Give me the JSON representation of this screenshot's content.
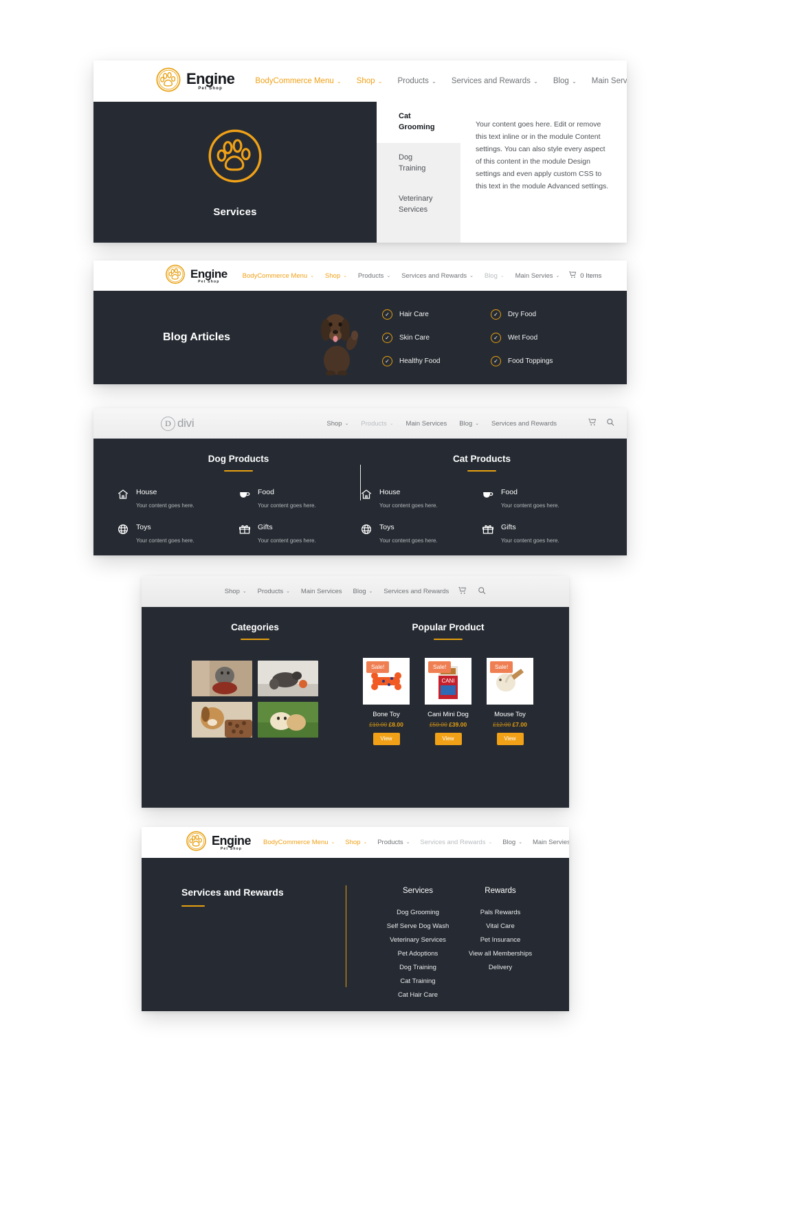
{
  "brand": {
    "name": "Engine",
    "tagline": "Pet Shop",
    "accent": "#e8a010",
    "dark": "#262b33",
    "sale_color": "#ef7f52"
  },
  "card1": {
    "nav": [
      {
        "label": "BodyCommerce Menu",
        "caret": "⌄",
        "style": "orange"
      },
      {
        "label": "Shop",
        "caret": "⌄",
        "style": "orange"
      },
      {
        "label": "Products",
        "caret": "⌄",
        "style": "gray"
      },
      {
        "label": "Services and Rewards",
        "caret": "⌄",
        "style": "gray"
      },
      {
        "label": "Blog",
        "caret": "⌄",
        "style": "gray"
      },
      {
        "label": "Main Servies",
        "caret": "⌄",
        "style": "gray"
      }
    ],
    "hero_title": "Services",
    "hero_icon": "paw-print-icon",
    "tabs": [
      {
        "label": "Cat Grooming",
        "active": true
      },
      {
        "label": "Dog Training",
        "active": false
      },
      {
        "label": "Veterinary Services",
        "active": false
      }
    ],
    "body_text": "Your content goes here. Edit or remove this text inline or in the module Content settings. You can also style every aspect of this content in the module Design settings and even apply custom CSS to this text in the module Advanced settings."
  },
  "card2": {
    "nav": [
      {
        "label": "BodyCommerce Menu",
        "caret": "⌄",
        "style": "orange"
      },
      {
        "label": "Shop",
        "caret": "⌄",
        "style": "orange"
      },
      {
        "label": "Products",
        "caret": "⌄",
        "style": "gray"
      },
      {
        "label": "Services and Rewards",
        "caret": "⌄",
        "style": "gray"
      },
      {
        "label": "Blog",
        "caret": "⌄",
        "style": "light"
      },
      {
        "label": "Main Servies",
        "caret": "⌄",
        "style": "gray"
      }
    ],
    "cart_label": "0 Items",
    "cart_icon": "shopping-cart-icon",
    "title": "Blog Articles",
    "image": "dog-photo",
    "checklist_left": [
      "Hair Care",
      "Skin Care",
      "Healthy Food"
    ],
    "checklist_right": [
      "Dry Food",
      "Wet Food",
      "Food Toppings"
    ],
    "check_icon": "check-circle-icon"
  },
  "card3": {
    "logo_word": "divi",
    "logo_letter": "D",
    "nav": [
      {
        "label": "Shop",
        "caret": "⌄",
        "style": "gray"
      },
      {
        "label": "Products",
        "caret": "⌄",
        "style": "light"
      },
      {
        "label": "Main Services",
        "caret": "",
        "style": "gray"
      },
      {
        "label": "Blog",
        "caret": "⌄",
        "style": "gray"
      },
      {
        "label": "Services and Rewards",
        "caret": "",
        "style": "gray"
      }
    ],
    "cart_icon": "shopping-cart-icon",
    "search_icon": "search-icon",
    "columns": [
      {
        "heading": "Dog Products",
        "features": [
          {
            "title": "House",
            "sub": "Your content goes here.",
            "icon": "house-icon"
          },
          {
            "title": "Food",
            "sub": "Your content goes here.",
            "icon": "food-bowl-icon"
          },
          {
            "title": "Toys",
            "sub": "Your content goes here.",
            "icon": "toy-ball-icon"
          },
          {
            "title": "Gifts",
            "sub": "Your content goes here.",
            "icon": "gift-icon"
          }
        ]
      },
      {
        "heading": "Cat Products",
        "features": [
          {
            "title": "House",
            "sub": "Your content goes here.",
            "icon": "house-icon"
          },
          {
            "title": "Food",
            "sub": "Your content goes here.",
            "icon": "food-bowl-icon"
          },
          {
            "title": "Toys",
            "sub": "Your content goes here.",
            "icon": "toy-ball-icon"
          },
          {
            "title": "Gifts",
            "sub": "Your content goes here.",
            "icon": "gift-icon"
          }
        ]
      }
    ]
  },
  "card4": {
    "nav": [
      {
        "label": "Shop",
        "caret": "⌄",
        "style": "gray"
      },
      {
        "label": "Products",
        "caret": "⌄",
        "style": "gray"
      },
      {
        "label": "Main Services",
        "caret": "",
        "style": "gray"
      },
      {
        "label": "Blog",
        "caret": "⌄",
        "style": "gray"
      },
      {
        "label": "Services and Rewards",
        "caret": "",
        "style": "gray"
      }
    ],
    "cart_icon": "shopping-cart-icon",
    "search_icon": "search-icon",
    "categories_heading": "Categories",
    "popular_heading": "Popular Product",
    "category_images": [
      "cat-at-bowl-photo",
      "cat-with-toy-photo",
      "dog-with-kibble-photo",
      "dogs-playing-photo"
    ],
    "products": [
      {
        "name": "Bone Toy",
        "badge": "Sale!",
        "old_price": "£10.00",
        "new_price": "£8.00",
        "button": "View",
        "image": "orange-bone-toy"
      },
      {
        "name": "Cani Mini Dog",
        "badge": "Sale!",
        "old_price": "£50.00",
        "new_price": "£39.00",
        "button": "View",
        "image": "cani-food-box"
      },
      {
        "name": "Mouse Toy",
        "badge": "Sale!",
        "old_price": "£12.00",
        "new_price": "£7.00",
        "button": "View",
        "image": "mouse-toy"
      }
    ]
  },
  "card5": {
    "nav": [
      {
        "label": "BodyCommerce Menu",
        "caret": "⌄",
        "style": "orange"
      },
      {
        "label": "Shop",
        "caret": "⌄",
        "style": "orange"
      },
      {
        "label": "Products",
        "caret": "⌄",
        "style": "gray"
      },
      {
        "label": "Services and Rewards",
        "caret": "⌄",
        "style": "light"
      },
      {
        "label": "Blog",
        "caret": "⌄",
        "style": "gray"
      },
      {
        "label": "Main Servies",
        "caret": "⌄",
        "style": "gray"
      }
    ],
    "title": "Services and Rewards",
    "columns": [
      {
        "heading": "Services",
        "items": [
          "Dog Grooming",
          "Self Serve Dog Wash",
          "Veterinary Services",
          "Pet Adoptions",
          "Dog Training",
          "Cat Training",
          "Cat Hair Care"
        ]
      },
      {
        "heading": "Rewards",
        "items": [
          "Pals Rewards",
          "Vital Care",
          "Pet Insurance",
          "View all Memberships",
          "Delivery"
        ]
      }
    ]
  }
}
